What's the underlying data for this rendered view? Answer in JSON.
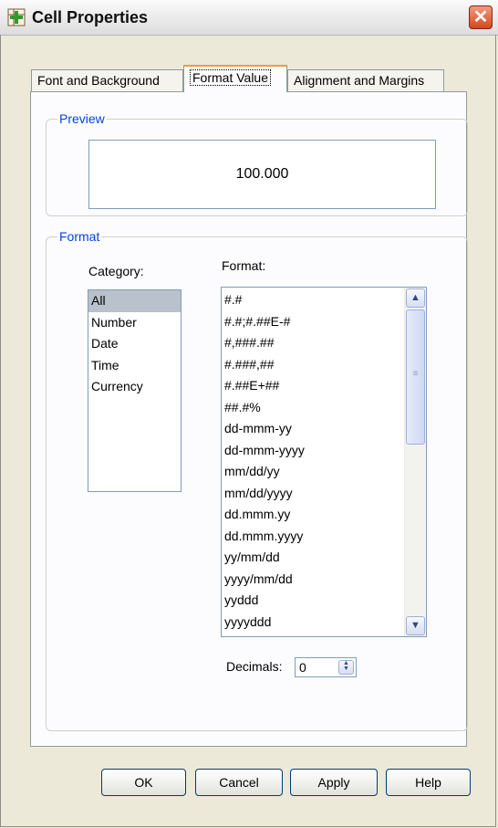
{
  "window": {
    "title": "Cell Properties",
    "app_icon": "plus-grid-icon",
    "close_icon": "close-icon",
    "close_glyph": "✕"
  },
  "tabs": [
    {
      "label": "Font and Background"
    },
    {
      "label": "Format Value",
      "active": true
    },
    {
      "label": "Alignment and Margins"
    }
  ],
  "preview": {
    "legend": "Preview",
    "value": "100.000"
  },
  "format_group": {
    "legend": "Format",
    "category_label": "Category:",
    "format_label": "Format:",
    "categories": [
      "All",
      "Number",
      "Date",
      "Time",
      "Currency"
    ],
    "selected_category": "All",
    "formats": [
      "#.#",
      "#.#;#.##E-#",
      "#,###.##",
      "#.###,##",
      "#.##E+##",
      "##.#%",
      "dd-mmm-yy",
      "dd-mmm-yyyy",
      "mm/dd/yy",
      "mm/dd/yyyy",
      "dd.mmm.yy",
      "dd.mmm.yyyy",
      "yy/mm/dd",
      "yyyy/mm/dd",
      "yyddd",
      "yyyyddd"
    ],
    "scroll_up_icon": "arrow-up-icon",
    "scroll_down_icon": "arrow-down-icon",
    "decimals_label": "Decimals:",
    "decimals_value": "0"
  },
  "buttons": {
    "ok": "OK",
    "cancel": "Cancel",
    "apply": "Apply",
    "help": "Help"
  },
  "colors": {
    "accent_tab": "#e8a03a",
    "legend": "#0046d5",
    "selection": "#b8c1cc"
  }
}
